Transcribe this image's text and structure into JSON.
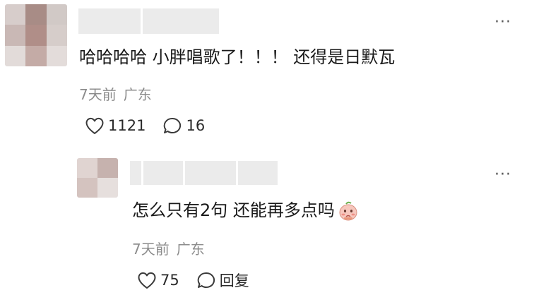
{
  "comments": [
    {
      "avatar_colors": [
        "#d7cdcb",
        "#a88c86",
        "#d1c9c6",
        "#c9b8b5",
        "#b08e88",
        "#d6cdca",
        "#e2dbd9",
        "#c4aba6",
        "#e3dcda"
      ],
      "content": "哈哈哈哈 小胖唱歌了！！！ 还得是日默瓦",
      "time": "7天前",
      "location": "广东",
      "likes": "1121",
      "replies": "16",
      "more_icon": "···"
    },
    {
      "avatar_colors": [
        "#e0d4d1",
        "#c6b2ae",
        "#d4c3bf",
        "#e6dfdd"
      ],
      "content": "怎么只有2句 还能再多点吗",
      "time": "7天前",
      "location": "广东",
      "likes": "75",
      "reply_label": "回复",
      "more_icon": "···",
      "emoji_icon": "pleading-face-emoji"
    }
  ],
  "icons": {
    "like": "heart-outline-icon",
    "comment": "speech-bubble-icon",
    "more": "ellipsis-icon"
  },
  "colors": {
    "text": "#1a1a1a",
    "meta": "#8c8c8c",
    "placeholder": "#ebebeb"
  }
}
